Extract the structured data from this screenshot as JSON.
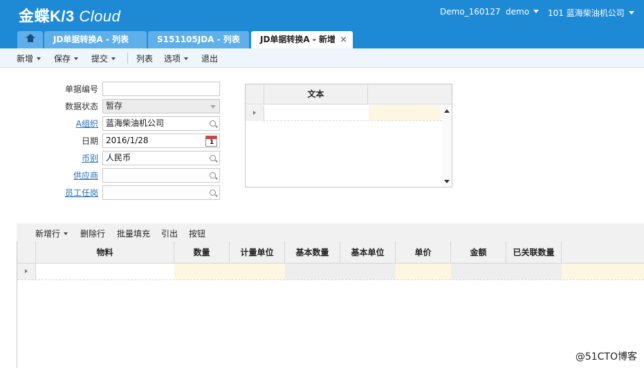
{
  "header": {
    "logo_main": "金蝶K/3",
    "logo_sub": "Cloud",
    "database": "Demo_160127",
    "user": "demo",
    "org": "101  蓝海柴油机公司",
    "brand_color": "#1e8ad6"
  },
  "tabs": [
    {
      "label": "JD单据转换A - 列表"
    },
    {
      "label": "S151105JDA - 列表"
    },
    {
      "label": "JD单据转换A - 新增",
      "close": "×"
    }
  ],
  "toolbar": {
    "new": "新增",
    "save": "保存",
    "submit": "提交",
    "list": "列表",
    "options": "选项",
    "exit": "退出"
  },
  "form": {
    "bill_no_label": "单据编号",
    "bill_no_value": "",
    "status_label": "数据状态",
    "status_value": "暂存",
    "org_label": "A组织",
    "org_value": "蓝海柴油机公司",
    "date_label": "日期",
    "date_value": "2016/1/28",
    "calendar_day": "1",
    "currency_label": "币别",
    "currency_value": "人民币",
    "supplier_label": "供应商",
    "supplier_value": "",
    "employee_label": "员工任岗",
    "employee_value": ""
  },
  "text_grid": {
    "column": "文本"
  },
  "detail": {
    "toolbar": {
      "add_row": "新增行",
      "delete_row": "删除行",
      "batch_fill": "批量填充",
      "pull": "引出",
      "button": "按钮"
    },
    "columns": [
      "物料",
      "数量",
      "计量单位",
      "基本数量",
      "基本单位",
      "单价",
      "金额",
      "已关联数量"
    ]
  },
  "watermark": "@51CTO博客"
}
